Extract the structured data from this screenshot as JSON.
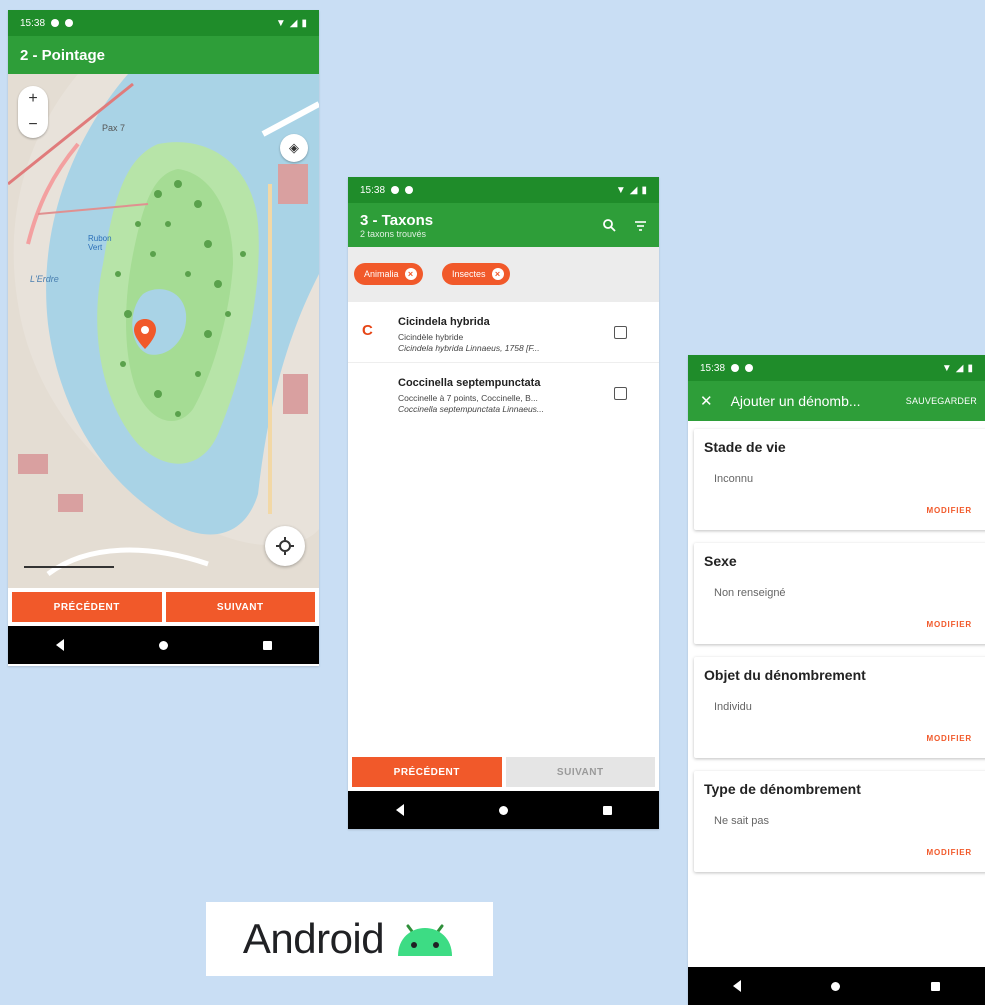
{
  "screen1": {
    "status_time": "15:38",
    "title": "2 - Pointage",
    "map_labels": [
      "Pax 7",
      "Rubon Vert",
      "L'Erdre"
    ],
    "buttons": {
      "previous": "PRÉCÉDENT",
      "next": "SUIVANT"
    }
  },
  "screen2": {
    "status_time": "15:38",
    "title": "3 - Taxons",
    "subtitle": "2 taxons trouvés",
    "filters": [
      "Animalia",
      "Insectes"
    ],
    "taxa": [
      {
        "letter": "C",
        "name": "Cicindela hybrida",
        "common": "Cicindèle hybride",
        "scientific": "Cicindela hybrida Linnaeus, 1758 [F..."
      },
      {
        "letter": "",
        "name": "Coccinella septempunctata",
        "common": "Coccinelle à 7 points, Coccinelle, B...",
        "scientific": "Coccinella septempunctata Linnaeus..."
      }
    ],
    "buttons": {
      "previous": "PRÉCÉDENT",
      "next": "SUIVANT"
    }
  },
  "screen3": {
    "status_time": "15:38",
    "title": "Ajouter un dénomb...",
    "save_label": "SAUVEGARDER",
    "cards": [
      {
        "title": "Stade de vie",
        "value": "Inconnu",
        "action": "MODIFIER"
      },
      {
        "title": "Sexe",
        "value": "Non renseigné",
        "action": "MODIFIER"
      },
      {
        "title": "Objet du dénombrement",
        "value": "Individu",
        "action": "MODIFIER"
      },
      {
        "title": "Type de dénombrement",
        "value": "Ne sait pas",
        "action": "MODIFIER"
      }
    ]
  },
  "badge": {
    "text": "Android"
  },
  "colors": {
    "green_dark": "#1f8c2a",
    "green": "#2e9e39",
    "orange": "#f1592a",
    "background": "#c9def4"
  }
}
